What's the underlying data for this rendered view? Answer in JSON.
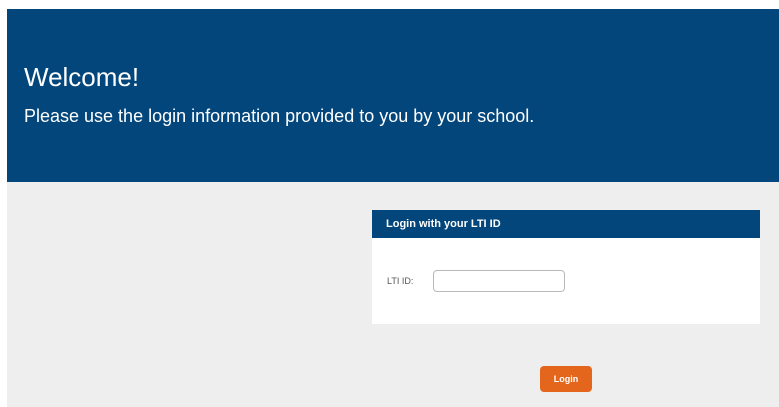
{
  "header": {
    "title": "Welcome!",
    "subtitle": "Please use the login information provided to you by your school."
  },
  "login_panel": {
    "heading": "Login with your LTI ID",
    "lti_label": "LTI ID:",
    "lti_value": "",
    "lti_placeholder": ""
  },
  "actions": {
    "login_label": "Login"
  },
  "colors": {
    "brand_blue": "#03467b",
    "accent_orange": "#e4661c",
    "page_background": "#eeeeee"
  }
}
